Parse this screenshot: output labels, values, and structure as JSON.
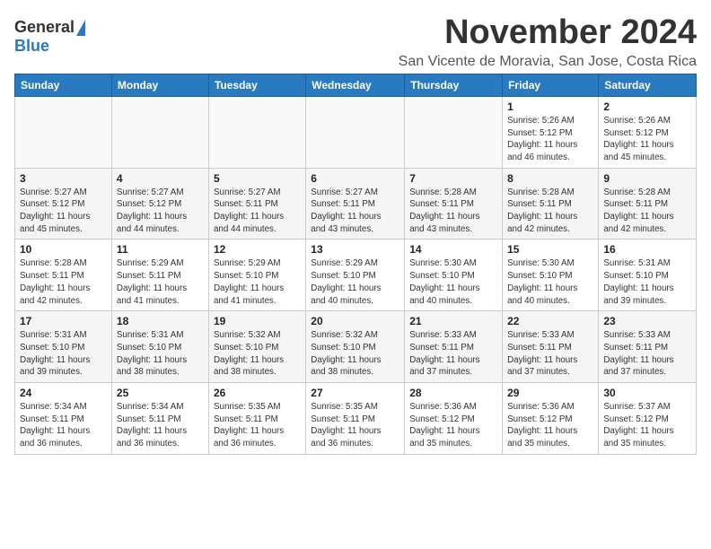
{
  "header": {
    "logo_general": "General",
    "logo_blue": "Blue",
    "month": "November 2024",
    "location": "San Vicente de Moravia, San Jose, Costa Rica"
  },
  "calendar": {
    "days_of_week": [
      "Sunday",
      "Monday",
      "Tuesday",
      "Wednesday",
      "Thursday",
      "Friday",
      "Saturday"
    ],
    "weeks": [
      [
        {
          "day": "",
          "info": ""
        },
        {
          "day": "",
          "info": ""
        },
        {
          "day": "",
          "info": ""
        },
        {
          "day": "",
          "info": ""
        },
        {
          "day": "",
          "info": ""
        },
        {
          "day": "1",
          "info": "Sunrise: 5:26 AM\nSunset: 5:12 PM\nDaylight: 11 hours\nand 46 minutes."
        },
        {
          "day": "2",
          "info": "Sunrise: 5:26 AM\nSunset: 5:12 PM\nDaylight: 11 hours\nand 45 minutes."
        }
      ],
      [
        {
          "day": "3",
          "info": "Sunrise: 5:27 AM\nSunset: 5:12 PM\nDaylight: 11 hours\nand 45 minutes."
        },
        {
          "day": "4",
          "info": "Sunrise: 5:27 AM\nSunset: 5:12 PM\nDaylight: 11 hours\nand 44 minutes."
        },
        {
          "day": "5",
          "info": "Sunrise: 5:27 AM\nSunset: 5:11 PM\nDaylight: 11 hours\nand 44 minutes."
        },
        {
          "day": "6",
          "info": "Sunrise: 5:27 AM\nSunset: 5:11 PM\nDaylight: 11 hours\nand 43 minutes."
        },
        {
          "day": "7",
          "info": "Sunrise: 5:28 AM\nSunset: 5:11 PM\nDaylight: 11 hours\nand 43 minutes."
        },
        {
          "day": "8",
          "info": "Sunrise: 5:28 AM\nSunset: 5:11 PM\nDaylight: 11 hours\nand 42 minutes."
        },
        {
          "day": "9",
          "info": "Sunrise: 5:28 AM\nSunset: 5:11 PM\nDaylight: 11 hours\nand 42 minutes."
        }
      ],
      [
        {
          "day": "10",
          "info": "Sunrise: 5:28 AM\nSunset: 5:11 PM\nDaylight: 11 hours\nand 42 minutes."
        },
        {
          "day": "11",
          "info": "Sunrise: 5:29 AM\nSunset: 5:11 PM\nDaylight: 11 hours\nand 41 minutes."
        },
        {
          "day": "12",
          "info": "Sunrise: 5:29 AM\nSunset: 5:10 PM\nDaylight: 11 hours\nand 41 minutes."
        },
        {
          "day": "13",
          "info": "Sunrise: 5:29 AM\nSunset: 5:10 PM\nDaylight: 11 hours\nand 40 minutes."
        },
        {
          "day": "14",
          "info": "Sunrise: 5:30 AM\nSunset: 5:10 PM\nDaylight: 11 hours\nand 40 minutes."
        },
        {
          "day": "15",
          "info": "Sunrise: 5:30 AM\nSunset: 5:10 PM\nDaylight: 11 hours\nand 40 minutes."
        },
        {
          "day": "16",
          "info": "Sunrise: 5:31 AM\nSunset: 5:10 PM\nDaylight: 11 hours\nand 39 minutes."
        }
      ],
      [
        {
          "day": "17",
          "info": "Sunrise: 5:31 AM\nSunset: 5:10 PM\nDaylight: 11 hours\nand 39 minutes."
        },
        {
          "day": "18",
          "info": "Sunrise: 5:31 AM\nSunset: 5:10 PM\nDaylight: 11 hours\nand 38 minutes."
        },
        {
          "day": "19",
          "info": "Sunrise: 5:32 AM\nSunset: 5:10 PM\nDaylight: 11 hours\nand 38 minutes."
        },
        {
          "day": "20",
          "info": "Sunrise: 5:32 AM\nSunset: 5:10 PM\nDaylight: 11 hours\nand 38 minutes."
        },
        {
          "day": "21",
          "info": "Sunrise: 5:33 AM\nSunset: 5:11 PM\nDaylight: 11 hours\nand 37 minutes."
        },
        {
          "day": "22",
          "info": "Sunrise: 5:33 AM\nSunset: 5:11 PM\nDaylight: 11 hours\nand 37 minutes."
        },
        {
          "day": "23",
          "info": "Sunrise: 5:33 AM\nSunset: 5:11 PM\nDaylight: 11 hours\nand 37 minutes."
        }
      ],
      [
        {
          "day": "24",
          "info": "Sunrise: 5:34 AM\nSunset: 5:11 PM\nDaylight: 11 hours\nand 36 minutes."
        },
        {
          "day": "25",
          "info": "Sunrise: 5:34 AM\nSunset: 5:11 PM\nDaylight: 11 hours\nand 36 minutes."
        },
        {
          "day": "26",
          "info": "Sunrise: 5:35 AM\nSunset: 5:11 PM\nDaylight: 11 hours\nand 36 minutes."
        },
        {
          "day": "27",
          "info": "Sunrise: 5:35 AM\nSunset: 5:11 PM\nDaylight: 11 hours\nand 36 minutes."
        },
        {
          "day": "28",
          "info": "Sunrise: 5:36 AM\nSunset: 5:12 PM\nDaylight: 11 hours\nand 35 minutes."
        },
        {
          "day": "29",
          "info": "Sunrise: 5:36 AM\nSunset: 5:12 PM\nDaylight: 11 hours\nand 35 minutes."
        },
        {
          "day": "30",
          "info": "Sunrise: 5:37 AM\nSunset: 5:12 PM\nDaylight: 11 hours\nand 35 minutes."
        }
      ]
    ]
  }
}
